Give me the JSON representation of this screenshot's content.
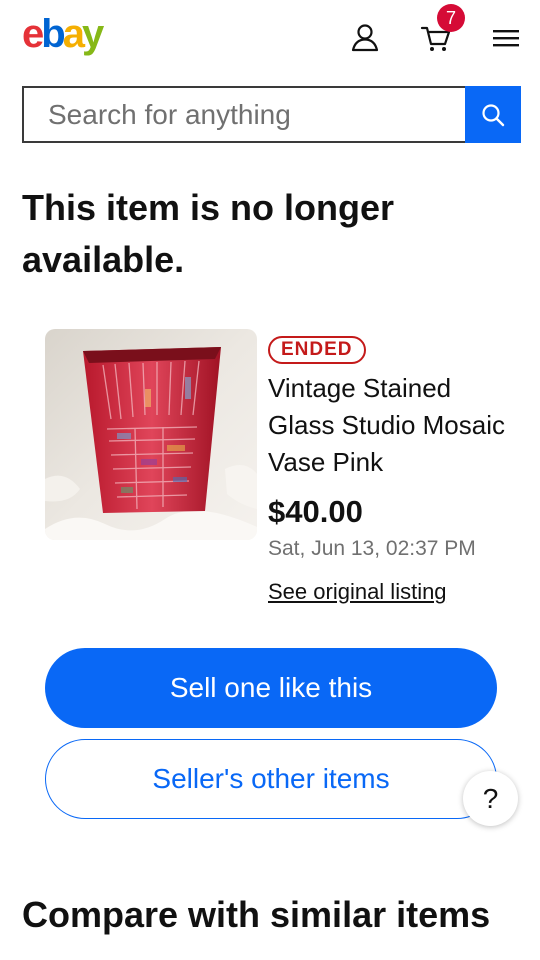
{
  "header": {
    "logo": {
      "e": "e",
      "b": "b",
      "a": "a",
      "y": "y"
    },
    "cart_count": "7",
    "icons": [
      "user-icon",
      "cart-icon",
      "hamburger-menu-icon"
    ],
    "brand_colors": {
      "red": "#e53238",
      "blue": "#0064d2",
      "yellow": "#f5af02",
      "green": "#86b817"
    }
  },
  "search": {
    "placeholder": "Search for anything",
    "value": "",
    "button_icon": "search-icon",
    "button_color": "#0968f6"
  },
  "main": {
    "headline": "This item is no longer available.",
    "item": {
      "status": "ENDED",
      "status_color": "#c41a1a",
      "title": "Vintage Stained Glass Studio Mosaic Vase Pink",
      "price": "$40.00",
      "date": "Sat, Jun 13, 02:37 PM",
      "link_label": "See original listing"
    },
    "actions": {
      "primary": "Sell one like this",
      "secondary": "Seller's other items",
      "help": "?"
    },
    "next_section_title": "Compare with similar items"
  }
}
